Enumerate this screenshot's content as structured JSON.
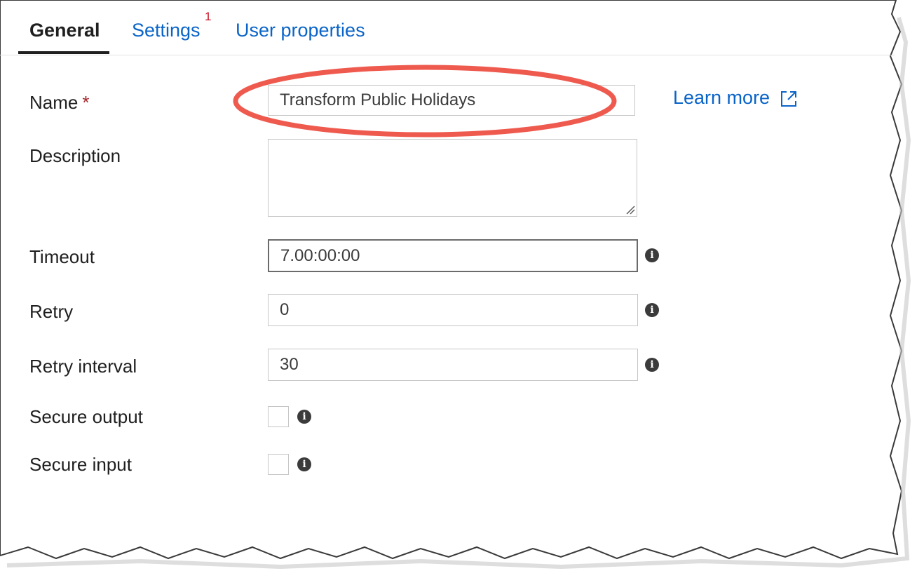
{
  "tabs": [
    {
      "label": "General",
      "active": true
    },
    {
      "label": "Settings",
      "badge": "1"
    },
    {
      "label": "User properties"
    }
  ],
  "form": {
    "name": {
      "label": "Name",
      "required_mark": "*",
      "value": "Transform Public Holidays"
    },
    "description": {
      "label": "Description",
      "value": ""
    },
    "timeout": {
      "label": "Timeout",
      "value": "7.00:00:00"
    },
    "retry": {
      "label": "Retry",
      "value": "0"
    },
    "retry_interval": {
      "label": "Retry interval",
      "value": "30"
    },
    "secure_output": {
      "label": "Secure output",
      "checked": false
    },
    "secure_input": {
      "label": "Secure input",
      "checked": false
    }
  },
  "learn_more": {
    "label": "Learn more",
    "icon": "external-link-icon"
  },
  "annotation": {
    "color": "#ef5a4f"
  },
  "colors": {
    "link": "#0a64c8",
    "required": "#a4262c",
    "badge": "#c50f1f"
  }
}
